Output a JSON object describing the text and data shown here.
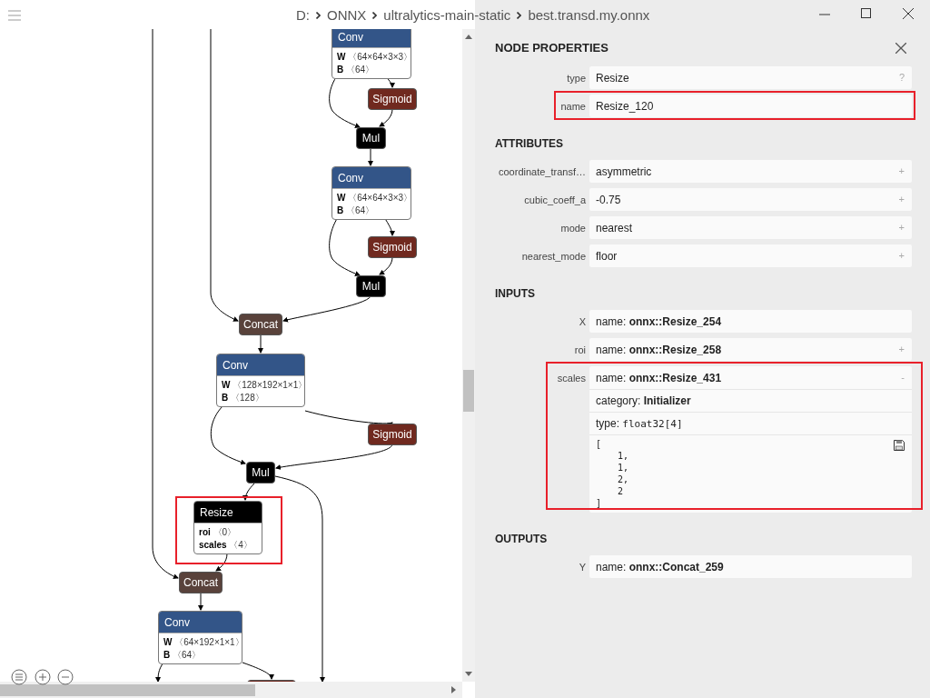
{
  "title_bar": {
    "breadcrumb": [
      "D:",
      "ONNX",
      "ultralytics-main-static",
      "best.transd.my.onnx"
    ]
  },
  "graph": {
    "nodes": [
      {
        "kind": "block",
        "color": "#335588",
        "label": "Conv",
        "attributes": [
          {
            "name": "W",
            "value": "〈64×64×3×3〉"
          },
          {
            "name": "B",
            "value": "〈64〉"
          }
        ],
        "highlighted": false
      },
      {
        "kind": "op",
        "color": "#70291f",
        "label": "Sigmoid"
      },
      {
        "kind": "op",
        "color": "#000000",
        "label": "Mul"
      },
      {
        "kind": "block",
        "color": "#335588",
        "label": "Conv",
        "attributes": [
          {
            "name": "W",
            "value": "〈64×64×3×3〉"
          },
          {
            "name": "B",
            "value": "〈64〉"
          }
        ],
        "highlighted": false
      },
      {
        "kind": "op",
        "color": "#70291f",
        "label": "Sigmoid"
      },
      {
        "kind": "op",
        "color": "#000000",
        "label": "Mul"
      },
      {
        "kind": "op",
        "color": "#59423b",
        "label": "Concat"
      },
      {
        "kind": "block",
        "color": "#335588",
        "label": "Conv",
        "attributes": [
          {
            "name": "W",
            "value": "〈128×192×1×1〉"
          },
          {
            "name": "B",
            "value": "〈128〉"
          }
        ],
        "highlighted": false
      },
      {
        "kind": "op",
        "color": "#70291f",
        "label": "Sigmoid"
      },
      {
        "kind": "op",
        "color": "#000000",
        "label": "Mul"
      },
      {
        "kind": "block",
        "color": "#000000",
        "label": "Resize",
        "attributes": [
          {
            "name": "roi",
            "value": "〈0〉"
          },
          {
            "name": "scales",
            "value": "〈4〉"
          }
        ],
        "highlighted": true
      },
      {
        "kind": "op",
        "color": "#59423b",
        "label": "Concat"
      },
      {
        "kind": "block",
        "color": "#335588",
        "label": "Conv",
        "attributes": [
          {
            "name": "W",
            "value": "〈64×192×1×1〉"
          },
          {
            "name": "B",
            "value": "〈64〉"
          }
        ],
        "highlighted": false
      },
      {
        "kind": "op",
        "color": "#70291f"
      }
    ]
  },
  "panel": {
    "title": "NODE PROPERTIES",
    "properties": [
      {
        "label": "type",
        "value": "Resize",
        "action": "?",
        "highlighted": false
      },
      {
        "label": "name",
        "value": "Resize_120",
        "highlighted": true
      }
    ],
    "attributes_heading": "ATTRIBUTES",
    "attributes": [
      {
        "label": "coordinate_transf…",
        "value": "asymmetric",
        "action": "+"
      },
      {
        "label": "cubic_coeff_a",
        "value": "-0.75",
        "action": "+"
      },
      {
        "label": "mode",
        "value": "nearest",
        "action": "+"
      },
      {
        "label": "nearest_mode",
        "value": "floor",
        "action": "+"
      }
    ],
    "inputs_heading": "INPUTS",
    "inputs": [
      {
        "label": "X",
        "key": "name:",
        "name": "onnx::Resize_254",
        "highlighted": false
      },
      {
        "label": "roi",
        "key": "name:",
        "name": "onnx::Resize_258",
        "action": "+",
        "highlighted": false
      },
      {
        "label": "scales",
        "key": "name:",
        "name": "onnx::Resize_431",
        "action": "-",
        "expanded": true,
        "highlighted": true,
        "details": [
          {
            "key": "category:",
            "value": "Initializer",
            "kind": "bold"
          },
          {
            "key": "type:",
            "value": "float32[4]",
            "kind": "code"
          }
        ],
        "tensor": "[\n    1,\n    1,\n    2,\n    2\n]"
      }
    ],
    "outputs_heading": "OUTPUTS",
    "outputs": [
      {
        "label": "Y",
        "key": "name:",
        "name": "onnx::Concat_259"
      }
    ]
  }
}
